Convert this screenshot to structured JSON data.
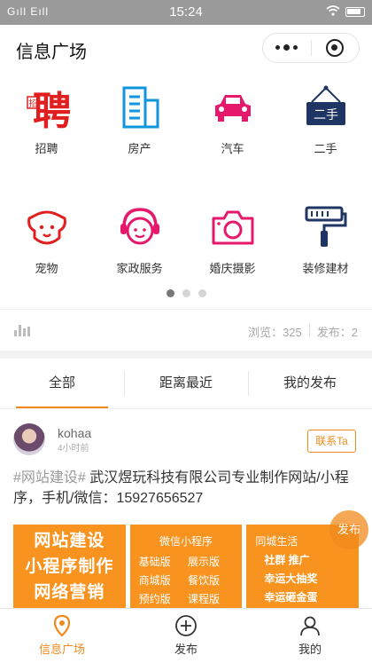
{
  "status_bar": {
    "signal": "Gıll Eıll",
    "time": "15:24"
  },
  "navbar": {
    "title": "信息广场"
  },
  "categories": [
    {
      "label": "招聘",
      "icon": "recruit-icon"
    },
    {
      "label": "房产",
      "icon": "building-icon"
    },
    {
      "label": "汽车",
      "icon": "car-icon"
    },
    {
      "label": "二手",
      "icon": "secondhand-sign-icon",
      "sign_text": "二手"
    },
    {
      "label": "宠物",
      "icon": "dog-icon"
    },
    {
      "label": "家政服务",
      "icon": "housekeeping-icon"
    },
    {
      "label": "婚庆摄影",
      "icon": "camera-icon"
    },
    {
      "label": "装修建材",
      "icon": "paint-roller-icon"
    }
  ],
  "recruit_glyph": "聘",
  "recruit_glyph_small": "招",
  "pager": {
    "total": 3,
    "active": 0
  },
  "stats": {
    "views": "浏览：325",
    "posts": "发布：2"
  },
  "tabs": [
    {
      "label": "全部",
      "active": true
    },
    {
      "label": "距离最近",
      "active": false
    },
    {
      "label": "我的发布",
      "active": false
    }
  ],
  "post": {
    "username": "kohaa",
    "time": "4小时前",
    "contact_label": "联系Ta",
    "tag": "#网站建设#",
    "content": " 武汉煜玩科技有限公司专业制作网站/小程序，手机/微信：15927656527",
    "image1": [
      "网站建设",
      "小程序制作",
      "网络营销"
    ],
    "image2": {
      "title": "微信小程序",
      "items": [
        "基础版",
        "展示版",
        "商城版",
        "餐饮版",
        "预约版",
        "课程版"
      ]
    },
    "image3": {
      "title": "同城生活",
      "lines": [
        "社群  推广",
        "幸运大抽奖",
        "幸运砸金蛋"
      ]
    }
  },
  "fab_label": "发布",
  "tabbar": [
    {
      "label": "信息广场",
      "active": true
    },
    {
      "label": "发布",
      "active": false
    },
    {
      "label": "我的",
      "active": false
    }
  ],
  "colors": {
    "accent": "#f08a1c",
    "red": "#e02020",
    "blue": "#1296db",
    "pink": "#e6186c",
    "navy": "#1f3563"
  }
}
